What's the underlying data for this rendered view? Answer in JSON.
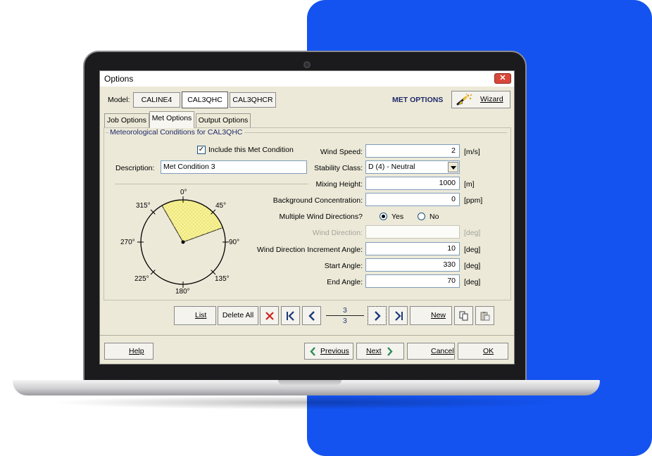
{
  "window": {
    "title": "Options",
    "close_glyph": "✕"
  },
  "model": {
    "label": "Model:",
    "buttons": [
      "CALINE4",
      "CAL3QHC",
      "CAL3QHCR"
    ],
    "selected": "CAL3QHC"
  },
  "header": {
    "section_title": "MET OPTIONS",
    "wizard_label": "Wizard"
  },
  "tabs": [
    "Job Options",
    "Met Options",
    "Output Options"
  ],
  "group_title": "Meteorological Conditions for CAL3QHC",
  "include_checkbox": {
    "label": "Include this Met Condition",
    "checked": true,
    "glyph": "✓"
  },
  "description": {
    "label": "Description:",
    "value": "Met Condition 3"
  },
  "fields": {
    "wind_speed": {
      "label": "Wind Speed:",
      "value": "2",
      "unit": "[m/s]"
    },
    "stability_class": {
      "label": "Stability Class:",
      "value": "D (4) - Neutral"
    },
    "mixing_height": {
      "label": "Mixing Height:",
      "value": "1000",
      "unit": "[m]"
    },
    "background_concentration": {
      "label": "Background Concentration:",
      "value": "0",
      "unit": "[ppm]"
    },
    "multiple_wind_directions": {
      "label": "Multiple Wind Directions?",
      "yes": "Yes",
      "no": "No",
      "selected": "Yes"
    },
    "wind_direction": {
      "label": "Wind Direction:",
      "value": "",
      "unit": "[deg]"
    },
    "increment_angle": {
      "label": "Wind Direction Increment Angle:",
      "value": "10",
      "unit": "[deg]"
    },
    "start_angle": {
      "label": "Start Angle:",
      "value": "330",
      "unit": "[deg]"
    },
    "end_angle": {
      "label": "End Angle:",
      "value": "70",
      "unit": "[deg]"
    }
  },
  "compass": {
    "labels": {
      "n": "0°",
      "ne": "45°",
      "e": "90°",
      "se": "135°",
      "s": "180°",
      "sw": "225°",
      "w": "270°",
      "nw": "315°"
    },
    "sector_start_deg": 330,
    "sector_end_deg": 70,
    "sector_color": "#f7f29a"
  },
  "navigator": {
    "list_label": "List",
    "delete_all_label": "Delete All",
    "current": "3",
    "total": "3",
    "new_label": "New"
  },
  "footer": {
    "help_label": "Help",
    "previous_label": "Previous",
    "next_label": "Next",
    "cancel_label": "Cancel",
    "ok_label": "OK"
  },
  "colors": {
    "accent_blue": "#1453f0",
    "title_navy": "#1f2a6b",
    "delete_red": "#d0241d"
  }
}
